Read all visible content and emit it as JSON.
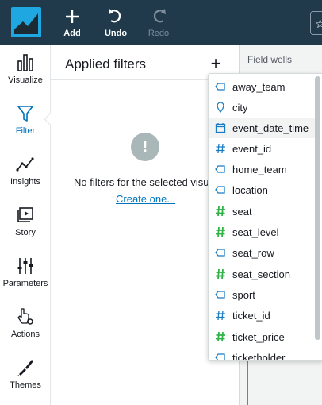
{
  "toolbar": {
    "add_label": "Add",
    "undo_label": "Undo",
    "redo_label": "Redo"
  },
  "nav": {
    "items": [
      {
        "label": "Visualize",
        "icon": "bar-chart-icon"
      },
      {
        "label": "Filter",
        "icon": "funnel-icon",
        "active": true
      },
      {
        "label": "Insights",
        "icon": "insights-icon"
      },
      {
        "label": "Story",
        "icon": "story-icon"
      },
      {
        "label": "Parameters",
        "icon": "sliders-icon"
      },
      {
        "label": "Actions",
        "icon": "pointer-gear-icon"
      },
      {
        "label": "Themes",
        "icon": "brush-icon"
      }
    ]
  },
  "panel": {
    "title": "Applied filters",
    "add_symbol": "+",
    "empty_icon": "!",
    "empty_message": "No filters for the selected visual.",
    "create_link": "Create one..."
  },
  "wells": {
    "label": "Field wells"
  },
  "dropdown": {
    "items": [
      {
        "label": "away_team",
        "type": "string"
      },
      {
        "label": "city",
        "type": "geo"
      },
      {
        "label": "event_date_time",
        "type": "date",
        "highlighted": true
      },
      {
        "label": "event_id",
        "type": "number"
      },
      {
        "label": "home_team",
        "type": "string"
      },
      {
        "label": "location",
        "type": "string"
      },
      {
        "label": "seat",
        "type": "measure"
      },
      {
        "label": "seat_level",
        "type": "measure"
      },
      {
        "label": "seat_row",
        "type": "string"
      },
      {
        "label": "seat_section",
        "type": "measure"
      },
      {
        "label": "sport",
        "type": "string"
      },
      {
        "label": "ticket_id",
        "type": "number"
      },
      {
        "label": "ticket_price",
        "type": "measure"
      },
      {
        "label": "ticketholder",
        "type": "string"
      }
    ]
  },
  "colors": {
    "topbar": "#203a4c",
    "accent": "#0073bb",
    "logo": "#1ea7e1",
    "dimension": "#1a7bc5",
    "measure": "#2fb344"
  }
}
